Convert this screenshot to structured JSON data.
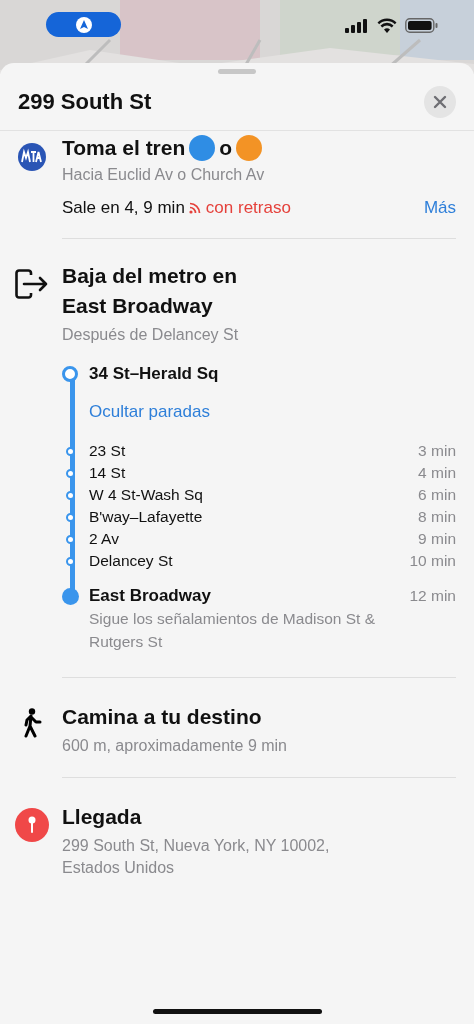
{
  "sheet": {
    "title": "299 South St"
  },
  "board": {
    "title_before": "Toma el tren",
    "lines": [
      {
        "color": "#2f8de4"
      },
      {
        "color": "#f39325"
      }
    ],
    "connector": "o",
    "direction": "Hacia Euclid Av o Church Av",
    "departure": "Sale en 4, 9 min",
    "delay": "con retraso",
    "more": "Más"
  },
  "exit": {
    "title": "Baja del metro en East Broadway",
    "subtitle": "Después de Delancey St",
    "origin": "34 St–Herald Sq",
    "toggle": "Ocultar paradas",
    "stops": [
      {
        "name": "23 St",
        "time": "3 min"
      },
      {
        "name": "14 St",
        "time": "4 min"
      },
      {
        "name": "W 4 St-Wash Sq",
        "time": "6 min"
      },
      {
        "name": "B'way–Lafayette",
        "time": "8 min"
      },
      {
        "name": "2 Av",
        "time": "9 min"
      },
      {
        "name": "Delancey St",
        "time": "10 min"
      }
    ],
    "destination": {
      "name": "East Broadway",
      "time": "12 min",
      "note": "Sigue los señalamientos de Madison St & Rutgers St"
    }
  },
  "walk": {
    "title": "Camina a tu destino",
    "subtitle": "600 m, aproximadamente 9 min"
  },
  "arrival": {
    "title": "Llegada",
    "address": "299 South St, Nueva York, NY  10002, Estados Unidos"
  }
}
